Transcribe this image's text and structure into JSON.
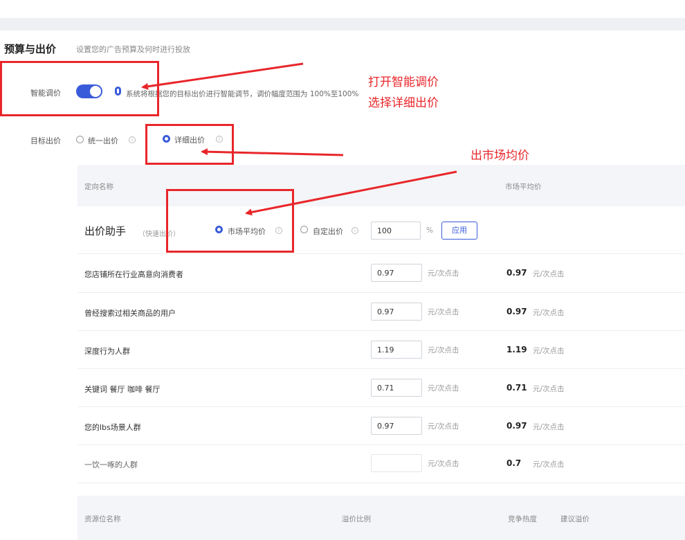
{
  "section": {
    "title": "预算与出价",
    "desc": "设置您的广告预算及何时进行投放"
  },
  "smart_bid": {
    "label": "智能调价",
    "enabled": true,
    "hint": "系统将根据您的目标出价进行智能调节，调价幅度范围为 100%至100%"
  },
  "target_bid": {
    "label": "目标出价",
    "options": [
      "统一出价",
      "详细出价"
    ],
    "selected": "详细出价"
  },
  "table": {
    "head_left": "定向名称",
    "head_right": "市场平均价"
  },
  "assistant": {
    "title": "出价助手",
    "subtitle": "（快速出价）",
    "options": [
      "市场平均价",
      "自定出价"
    ],
    "selected": "市场平均价",
    "value": "100",
    "percent": "%",
    "apply_label": "应用"
  },
  "rows": [
    {
      "name": "您店铺所在行业高意向消费者",
      "bid": "0.97",
      "unit": "元/次点击",
      "market": "0.97",
      "market_unit": "元/次点击"
    },
    {
      "name": "曾经搜索过相关商品的用户",
      "bid": "0.97",
      "unit": "元/次点击",
      "market": "0.97",
      "market_unit": "元/次点击"
    },
    {
      "name": "深度行为人群",
      "bid": "1.19",
      "unit": "元/次点击",
      "market": "1.19",
      "market_unit": "元/次点击"
    },
    {
      "name": "关键词 餐厅 咖啡 餐厅",
      "bid": "0.71",
      "unit": "元/次点击",
      "market": "0.71",
      "market_unit": "元/次点击"
    },
    {
      "name": "您的lbs场景人群",
      "bid": "0.97",
      "unit": "元/次点击",
      "market": "0.97",
      "market_unit": "元/次点击"
    },
    {
      "name": "一饮一啄的人群",
      "bid": "",
      "unit": "元/次点击",
      "market": "0.7",
      "market_unit": "元/次点击"
    }
  ],
  "footer": {
    "col1": "资源位名称",
    "col2": "溢价比例",
    "col3": "竞争热度",
    "col4": "建议溢价"
  },
  "annotations": {
    "note1_line1": "打开智能调价",
    "note1_line2": "选择详细出价",
    "note2": "出市场均价"
  },
  "colors": {
    "accent": "#3a5bd9",
    "annotation_red": "#e8262a"
  }
}
